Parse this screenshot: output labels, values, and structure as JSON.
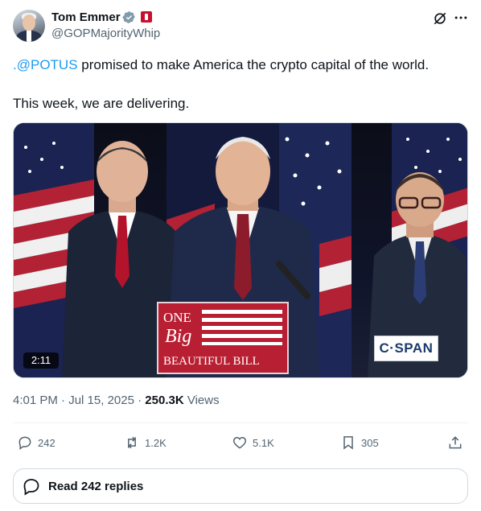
{
  "author": {
    "name": "Tom Emmer",
    "handle": "@GOPMajorityWhip",
    "verified_badge_icon": "verified-badge-icon",
    "affiliation_icon": "us-house-flag-icon"
  },
  "tweet": {
    "mention": ".@POTUS",
    "line1_rest": " promised to make America the crypto capital of the world.",
    "line2": "This week, we are delivering."
  },
  "video": {
    "duration": "2:11",
    "network_logo": "C·SPAN",
    "podium_sign": [
      "ONE",
      "Big",
      "BEAUTIFUL BILL"
    ]
  },
  "meta": {
    "time": "4:01 PM",
    "separator": " · ",
    "date": "Jul 15, 2025",
    "views_count": "250.3K",
    "views_label": " Views"
  },
  "actions": {
    "replies": "242",
    "reposts": "1.2K",
    "likes": "5.1K",
    "bookmarks": "305"
  },
  "read_replies_label": "Read 242 replies",
  "colors": {
    "link": "#1d9bf0",
    "text": "#0f1419",
    "secondary": "#536471",
    "badge": "#829aab",
    "flag": "#c8102e"
  }
}
